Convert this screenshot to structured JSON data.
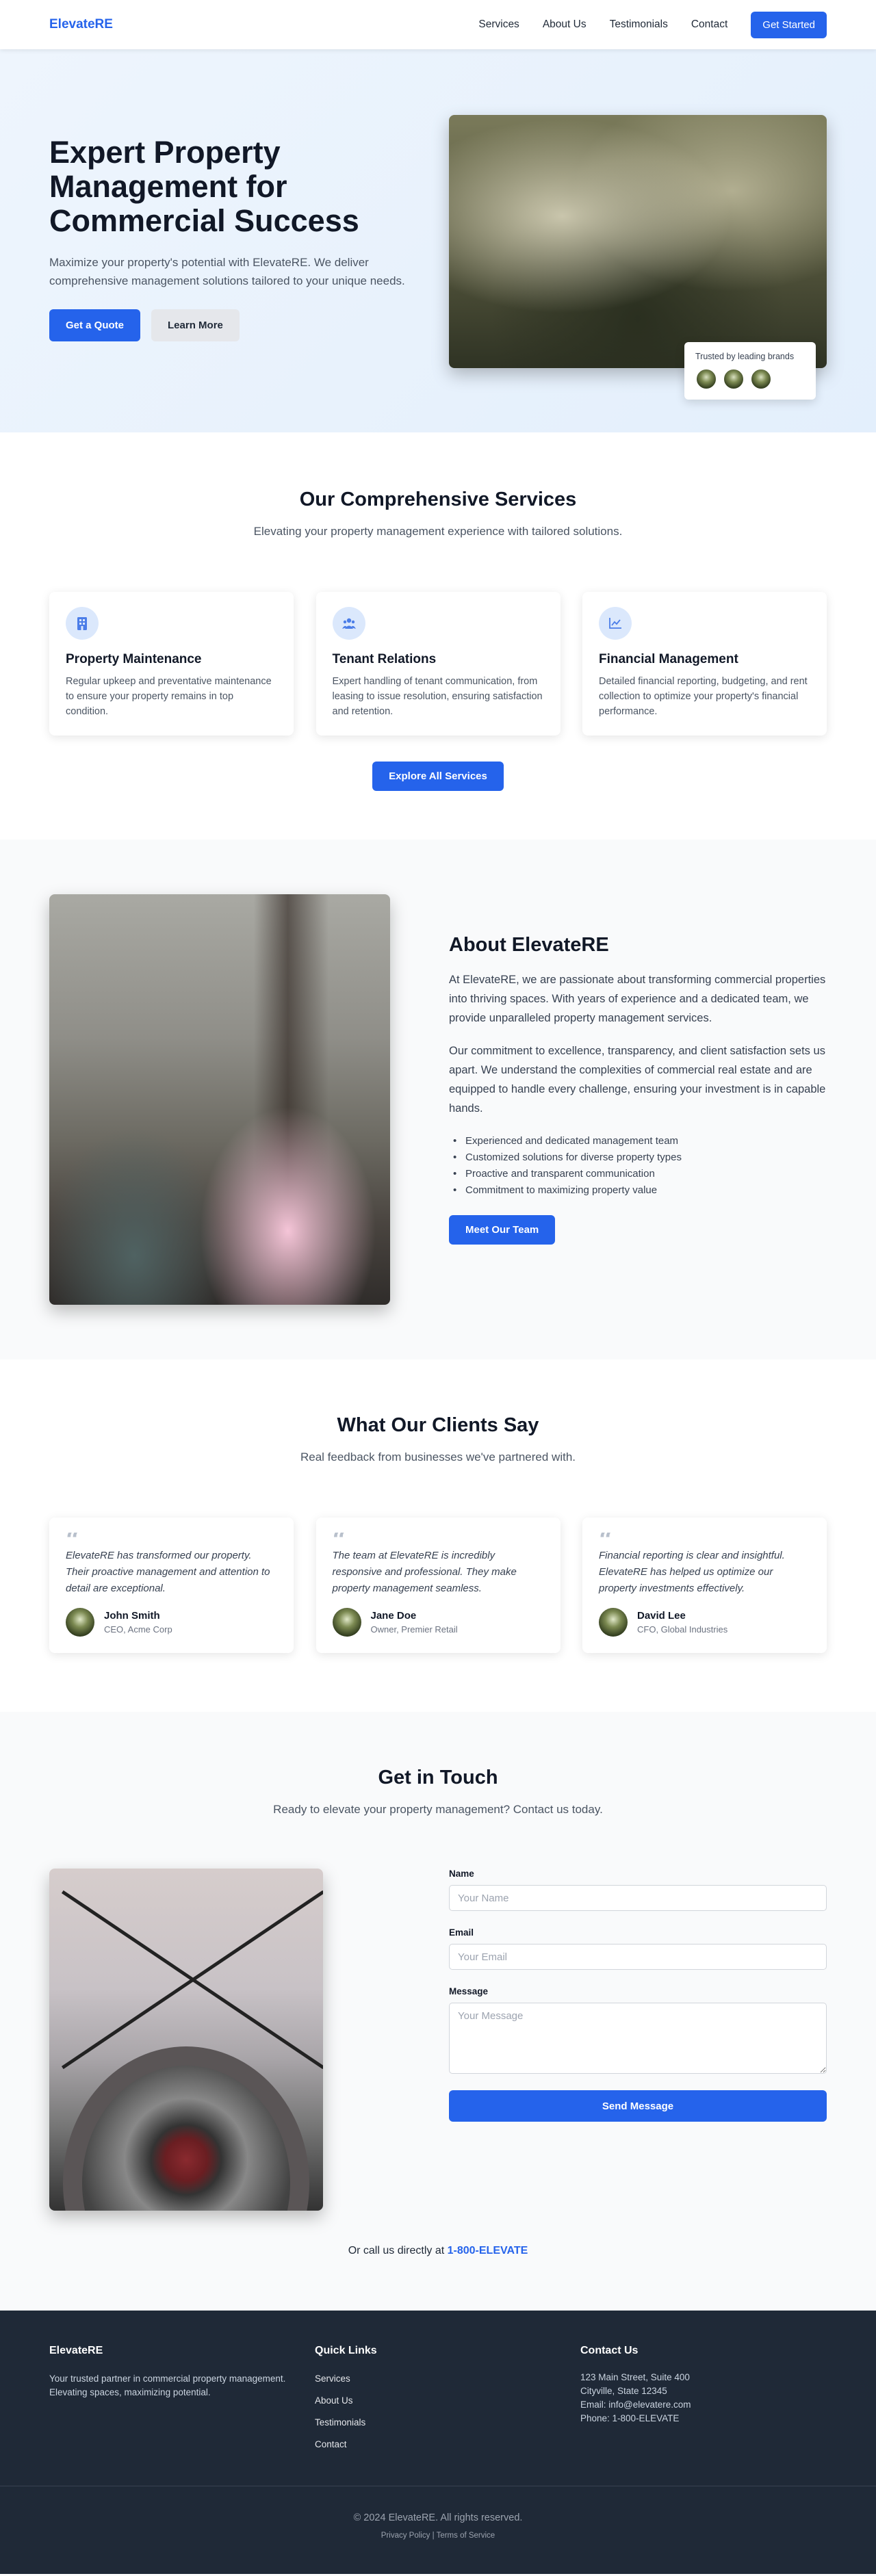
{
  "nav": {
    "brand": "ElevateRE",
    "links": [
      "Services",
      "About Us",
      "Testimonials",
      "Contact"
    ],
    "cta": "Get Started"
  },
  "hero": {
    "title": "Expert Property Management for Commercial Success",
    "subtitle": "Maximize your property's potential with ElevateRE. We deliver comprehensive management solutions tailored to your unique needs.",
    "primary_button": "Get a Quote",
    "secondary_button": "Learn More",
    "trust_text": "Trusted by leading brands"
  },
  "services": {
    "title": "Our Comprehensive Services",
    "subtitle": "Elevating your property management experience with tailored solutions.",
    "cards": [
      {
        "icon": "building-icon",
        "title": "Property Maintenance",
        "text": "Regular upkeep and preventative maintenance to ensure your property remains in top condition."
      },
      {
        "icon": "users-icon",
        "title": "Tenant Relations",
        "text": "Expert handling of tenant communication, from leasing to issue resolution, ensuring satisfaction and retention."
      },
      {
        "icon": "chart-line-icon",
        "title": "Financial Management",
        "text": "Detailed financial reporting, budgeting, and rent collection to optimize your property's financial performance."
      }
    ],
    "button": "Explore All Services"
  },
  "about": {
    "title": "About ElevateRE",
    "paragraph1": "At ElevateRE, we are passionate about transforming commercial properties into thriving spaces. With years of experience and a dedicated team, we provide unparalleled property management services.",
    "paragraph2": "Our commitment to excellence, transparency, and client satisfaction sets us apart. We understand the complexities of commercial real estate and are equipped to handle every challenge, ensuring your investment is in capable hands.",
    "list": [
      "Experienced and dedicated management team",
      "Customized solutions for diverse property types",
      "Proactive and transparent communication",
      "Commitment to maximizing property value"
    ],
    "button": "Meet Our Team"
  },
  "testimonials": {
    "title": "What Our Clients Say",
    "subtitle": "Real feedback from businesses we've partnered with.",
    "quote_mark": "“",
    "items": [
      {
        "text": "ElevateRE has transformed our property. Their proactive management and attention to detail are exceptional.",
        "name": "John Smith",
        "role": "CEO, Acme Corp"
      },
      {
        "text": "The team at ElevateRE is incredibly responsive and professional. They make property management seamless.",
        "name": "Jane Doe",
        "role": "Owner, Premier Retail"
      },
      {
        "text": "Financial reporting is clear and insightful. ElevateRE has helped us optimize our property investments effectively.",
        "name": "David Lee",
        "role": "CFO, Global Industries"
      }
    ]
  },
  "contact": {
    "title": "Get in Touch",
    "subtitle": "Ready to elevate your property management? Contact us today.",
    "name_label": "Name",
    "name_placeholder": "Your Name",
    "email_label": "Email",
    "email_placeholder": "Your Email",
    "message_label": "Message",
    "message_placeholder": "Your Message",
    "submit": "Send Message",
    "call_prefix": "Or call us directly at",
    "phone": "1-800-ELEVATE"
  },
  "footer": {
    "brand": "ElevateRE",
    "tagline": "Your trusted partner in commercial property management. Elevating spaces, maximizing potential.",
    "quick_links_title": "Quick Links",
    "quick_links": [
      "Services",
      "About Us",
      "Testimonials",
      "Contact"
    ],
    "contact_title": "Contact Us",
    "address1": "123 Main Street, Suite 400",
    "address2": "Cityville, State 12345",
    "email": "Email: info@elevatere.com",
    "phone": "Phone: 1-800-ELEVATE",
    "copyright": "© 2024 ElevateRE. All rights reserved.",
    "privacy": "Privacy Policy",
    "separator": "|",
    "terms": "Terms of Service"
  },
  "colors": {
    "accent": "#2563eb",
    "footer_bg": "#1f2937",
    "hero_bg": "#e3effc"
  }
}
